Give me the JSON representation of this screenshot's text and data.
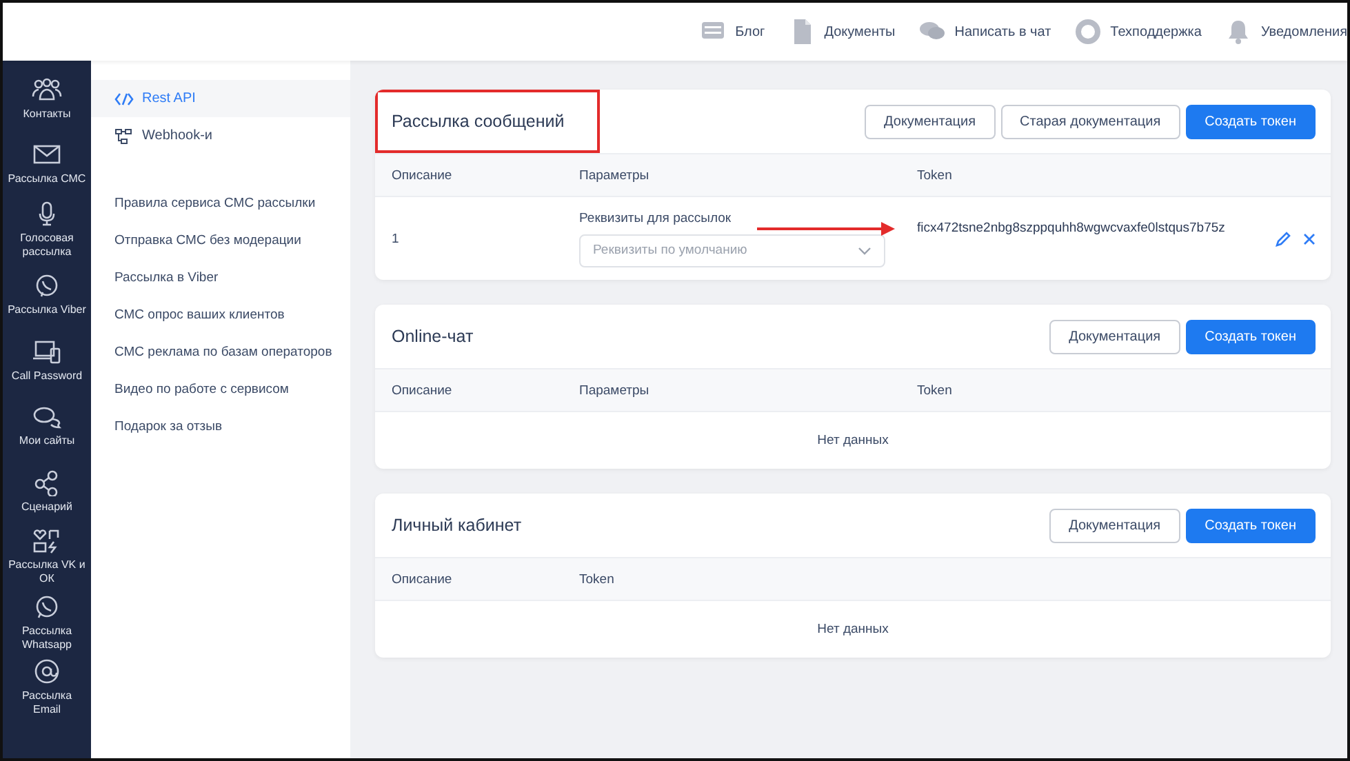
{
  "topbar": {
    "links": [
      {
        "label": "Блог"
      },
      {
        "label": "Документы"
      },
      {
        "label": "Написать в чат"
      },
      {
        "label": "Техподдержка"
      },
      {
        "label": "Уведомления"
      }
    ]
  },
  "sidebar": {
    "items": [
      {
        "label": "Контакты"
      },
      {
        "label": "Рассылка СМС"
      },
      {
        "label": "Голосовая рассылка"
      },
      {
        "label": "Рассылка Viber"
      },
      {
        "label": "Call Password"
      },
      {
        "label": "Мои сайты"
      },
      {
        "label": "Сценарий"
      },
      {
        "label": "Рассылка VK и ОК"
      },
      {
        "label": "Рассылка Whatsapp"
      },
      {
        "label": "Рассылка Email"
      }
    ]
  },
  "submenu": {
    "tabs": [
      {
        "label": "Rest API",
        "selected": true
      },
      {
        "label": "Webhook-и",
        "selected": false
      }
    ],
    "links": [
      "Правила сервиса СМС рассылки",
      "Отправка СМС без модерации",
      "Рассылка в Viber",
      "СМС опрос ваших клиентов",
      "СМС реклама по базам операторов",
      "Видео по работе с сервисом",
      "Подарок за отзыв"
    ]
  },
  "cards": [
    {
      "title": "Рассылка сообщений",
      "highlighted": true,
      "buttons": [
        {
          "label": "Документация",
          "kind": "default"
        },
        {
          "label": "Старая документация",
          "kind": "default"
        },
        {
          "label": "Создать токен",
          "kind": "primary"
        }
      ],
      "columns": [
        "Описание",
        "Параметры",
        "Token"
      ],
      "rows": [
        {
          "description": "1",
          "param_label": "Реквизиты для рассылок",
          "param_select": {
            "placeholder": "Реквизиты по умолчанию"
          },
          "token": "ficx472tsne2nbg8szppquhh8wgwcvaxfe0lstqus7b75z",
          "arrow": true
        }
      ]
    },
    {
      "title": "Online-чат",
      "highlighted": false,
      "buttons": [
        {
          "label": "Документация",
          "kind": "default"
        },
        {
          "label": "Создать токен",
          "kind": "primary"
        }
      ],
      "columns": [
        "Описание",
        "Параметры",
        "Token"
      ],
      "empty_text": "Нет данных"
    },
    {
      "title": "Личный кабинет",
      "highlighted": false,
      "buttons": [
        {
          "label": "Документация",
          "kind": "default"
        },
        {
          "label": "Создать токен",
          "kind": "primary"
        }
      ],
      "columns": [
        "Описание",
        "Token"
      ],
      "empty_text": "Нет данных"
    }
  ]
}
